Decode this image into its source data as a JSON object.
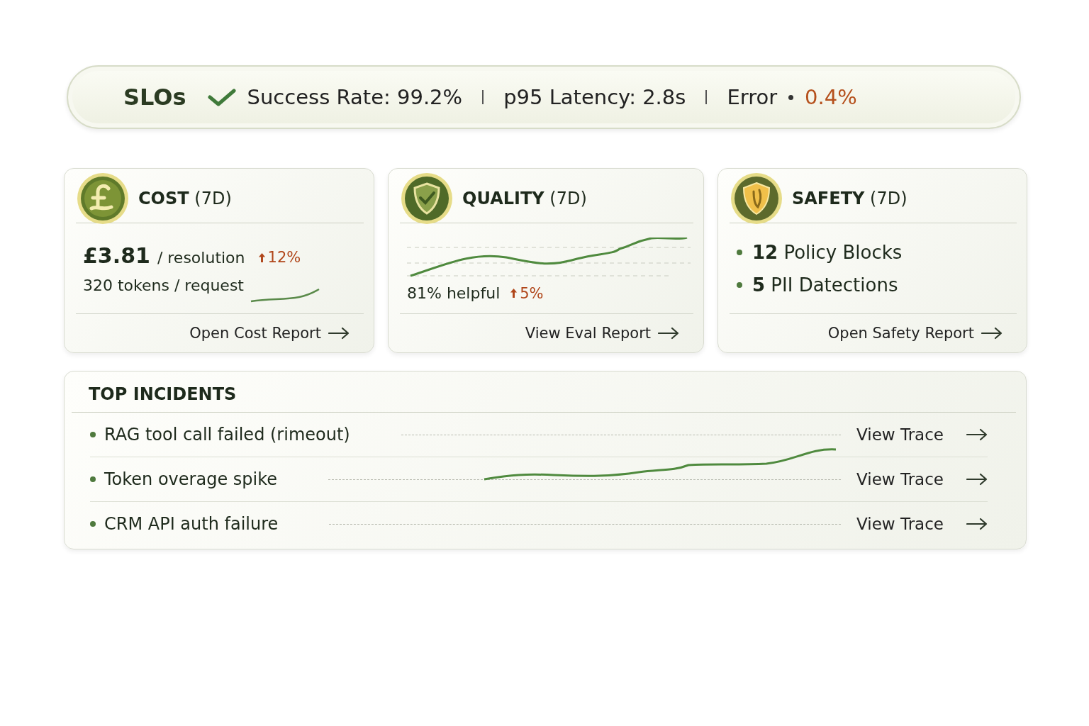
{
  "slo_bar": {
    "title": "SLOs",
    "metrics": [
      {
        "kind": "plain",
        "text": "Success Rate: 99.2%"
      },
      {
        "kind": "plain",
        "text": "p95 Latency: 2.8s"
      },
      {
        "kind": "alert",
        "text": "Error",
        "value": "0.4%"
      }
    ]
  },
  "cards": [
    {
      "kind": "cost",
      "title": "COST",
      "period": "(7D)",
      "value": "£3.81",
      "unit": "/ resolution",
      "trend": {
        "value": "12%"
      },
      "secondary": "320 tokens / request",
      "link": "Open Cost Report"
    },
    {
      "kind": "quality",
      "title": "QUALITY",
      "period": "(7D)",
      "value": "81% helpful",
      "trend": {
        "value": "5%"
      },
      "link": "View Eval Report"
    },
    {
      "kind": "safety",
      "title": "SAFETY",
      "period": "(7D)",
      "items": [
        {
          "count": "12",
          "label": "Policy Blocks"
        },
        {
          "count": "5",
          "label": "PII Datections"
        }
      ],
      "link": "Open Safety Report"
    }
  ],
  "incidents": {
    "title": "TOP INCIDENTS",
    "rows": [
      {
        "title": "RAG tool call failed (rimeout)",
        "action": "View Trace"
      },
      {
        "title": "Token overage spike",
        "action": "View Trace"
      },
      {
        "title": "CRM API auth failure",
        "action": "View Trace"
      }
    ]
  }
}
